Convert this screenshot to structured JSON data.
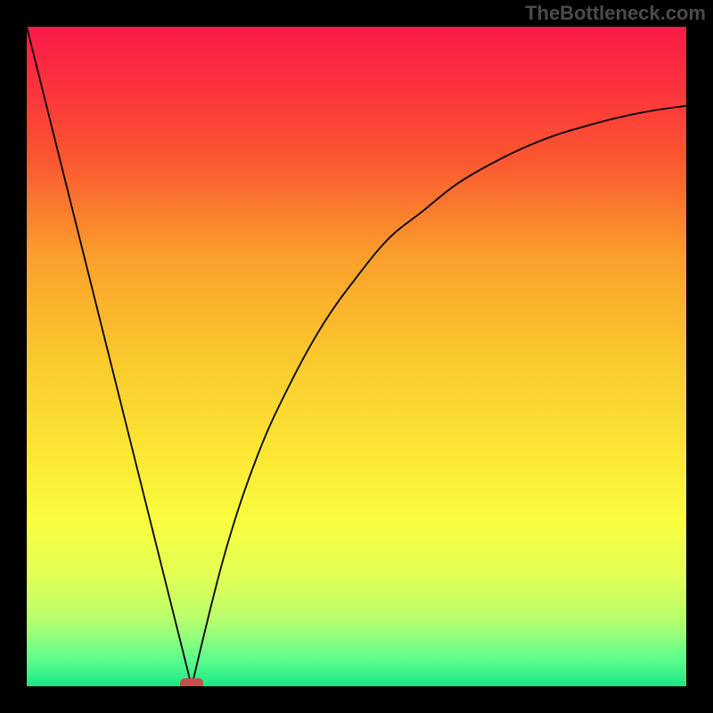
{
  "attribution": "TheBottleneck.com",
  "chart_data": {
    "type": "line",
    "title": "",
    "xlabel": "",
    "ylabel": "",
    "xlim": [
      0,
      100
    ],
    "ylim": [
      0,
      100
    ],
    "grid": false,
    "legend": false,
    "background": "rainbow-vertical-gradient (red→orange→yellow→green)",
    "series": [
      {
        "name": "bottleneck-curve",
        "segment": "left-linear",
        "x": [
          0,
          25
        ],
        "y": [
          100,
          0
        ]
      },
      {
        "name": "bottleneck-curve",
        "segment": "right-rising",
        "x": [
          25,
          30,
          35,
          40,
          45,
          50,
          55,
          60,
          65,
          70,
          75,
          80,
          85,
          90,
          95,
          100
        ],
        "y": [
          0,
          20,
          35,
          46,
          55,
          62,
          68,
          72,
          76,
          79,
          81.5,
          83.5,
          85,
          86.3,
          87.3,
          88
        ]
      }
    ],
    "marker": {
      "x": 25,
      "y": 0,
      "color": "#c0504d",
      "shape": "rounded-rect"
    },
    "gradient_stops": [
      {
        "offset": 0.0,
        "color": "#fb1b49"
      },
      {
        "offset": 0.08,
        "color": "#fc2f3e"
      },
      {
        "offset": 0.2,
        "color": "#fb5630"
      },
      {
        "offset": 0.35,
        "color": "#faa02c"
      },
      {
        "offset": 0.5,
        "color": "#fac82d"
      },
      {
        "offset": 0.65,
        "color": "#fbe734"
      },
      {
        "offset": 0.75,
        "color": "#fafd3e"
      },
      {
        "offset": 0.83,
        "color": "#e3ff54"
      },
      {
        "offset": 0.9,
        "color": "#b7ff6f"
      },
      {
        "offset": 0.96,
        "color": "#5dfd8d"
      },
      {
        "offset": 1.0,
        "color": "#17e884"
      }
    ]
  }
}
